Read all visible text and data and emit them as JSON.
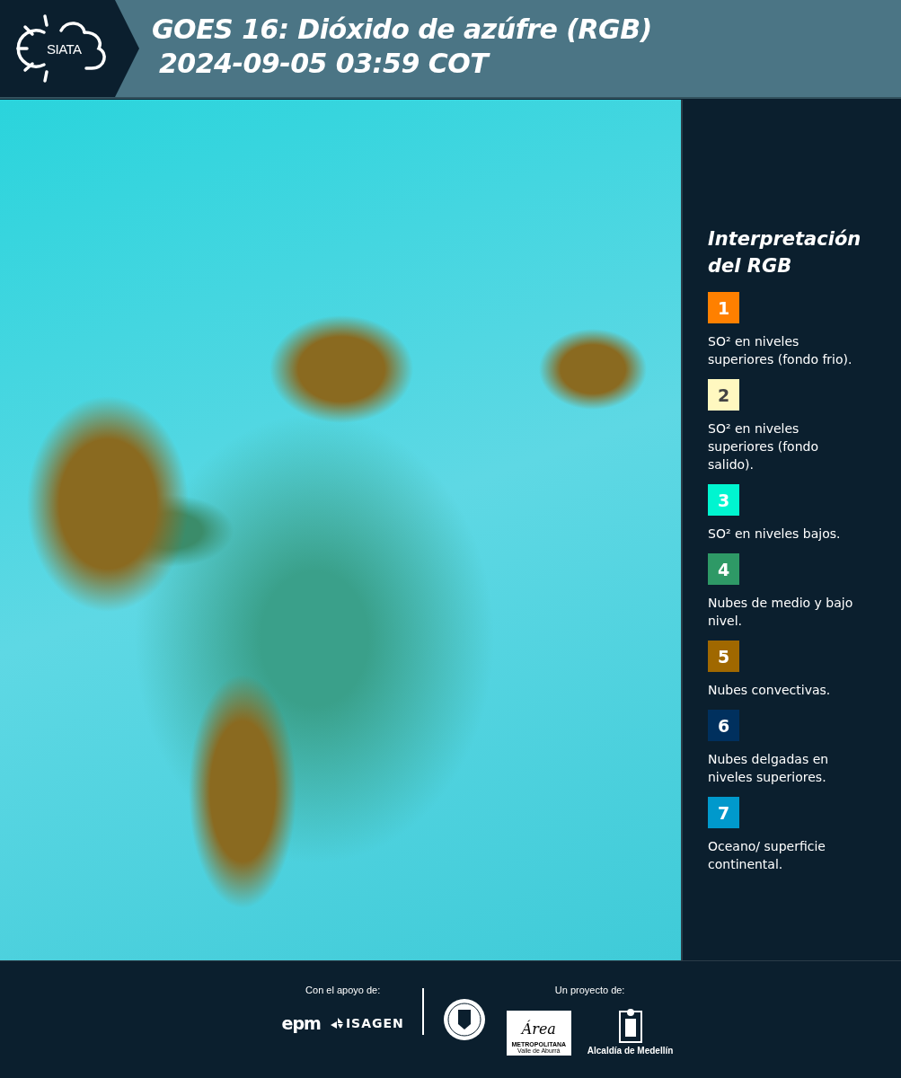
{
  "header": {
    "logo_text": "SIATA",
    "title": "GOES 16: Dióxido de azúfre (RGB)",
    "subtitle": "2024-09-05 03:59 COT"
  },
  "legend": {
    "title": "Interpretación del RGB",
    "items": [
      {
        "number": "1",
        "color": "#ff8000",
        "text": "SO² en niveles superiores (fondo frio)."
      },
      {
        "number": "2",
        "color": "#fff8c0",
        "text": "SO² en niveles superiores (fondo salido)."
      },
      {
        "number": "3",
        "color": "#00f5d0",
        "text": "SO² en niveles bajos."
      },
      {
        "number": "4",
        "color": "#2e9966",
        "text": "Nubes de medio y bajo nivel."
      },
      {
        "number": "5",
        "color": "#a06800",
        "text": "Nubes convectivas."
      },
      {
        "number": "6",
        "color": "#00305e",
        "text": "Nubes delgadas en niveles superiores."
      },
      {
        "number": "7",
        "color": "#0099cc",
        "text": "Oceano/ superficie continental."
      }
    ]
  },
  "footer": {
    "support_label": "Con el apoyo de:",
    "support_logos": [
      "epm",
      "ISAGEN"
    ],
    "project_label": "Un proyecto de:",
    "area_logo": {
      "script": "Área",
      "line_1": "METROPOLITANA",
      "line_2": "Valle de Aburrá"
    },
    "alcaldia": "Alcaldía de Medellín"
  }
}
